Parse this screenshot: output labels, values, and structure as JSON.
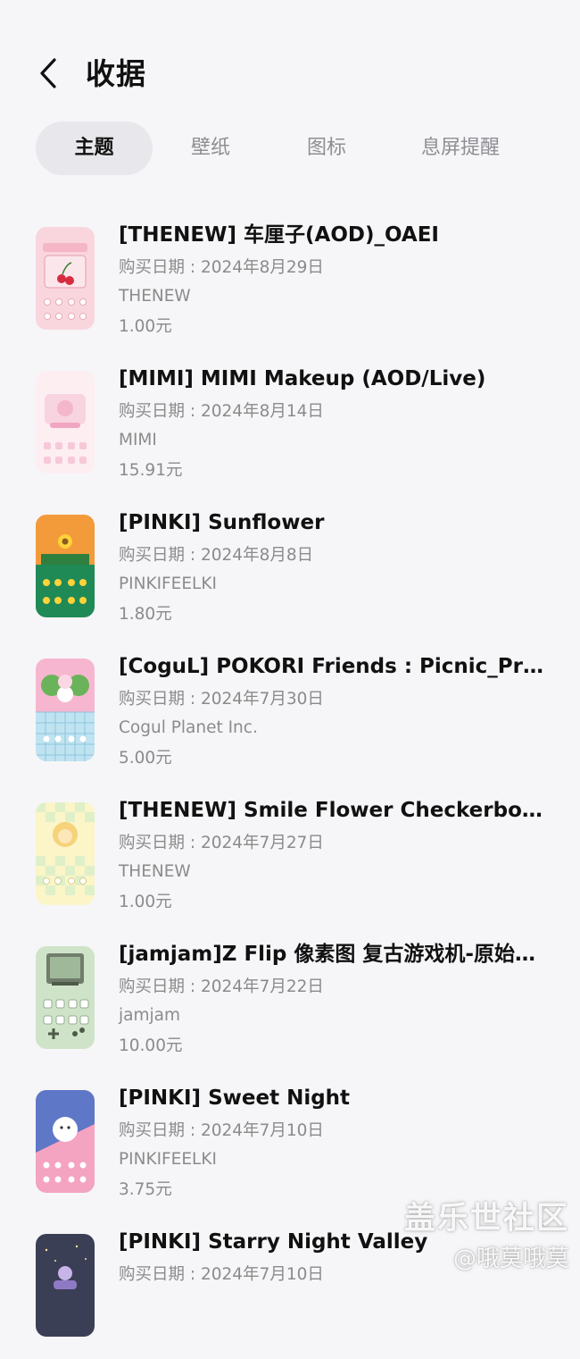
{
  "header": {
    "title": "收据"
  },
  "tabs": [
    {
      "label": "主题",
      "active": true
    },
    {
      "label": "壁纸",
      "active": false
    },
    {
      "label": "图标",
      "active": false
    },
    {
      "label": "息屏提醒",
      "active": false
    }
  ],
  "items": [
    {
      "name": "[THENEW] 车厘子(AOD)_OAEI",
      "date": "购买日期 : 2024年8月29日",
      "vendor": "THENEW",
      "price": "1.00元",
      "thumb_colors": [
        "#f9d6de",
        "#f6c2cf"
      ]
    },
    {
      "name": "[MIMI] MIMI Makeup (AOD/Live)",
      "date": "购买日期 : 2024年8月14日",
      "vendor": "MIMI",
      "price": "15.91元",
      "thumb_colors": [
        "#fdeef2",
        "#f7d5e0"
      ]
    },
    {
      "name": "[PINKI] Sunflower",
      "date": "购买日期 : 2024年8月8日",
      "vendor": "PINKIFEELKI",
      "price": "1.80元",
      "thumb_colors": [
        "#f39a3a",
        "#1f8a56"
      ]
    },
    {
      "name": "[CoguL] POKORI Friends : Picnic_Premium",
      "date": "购买日期 : 2024年7月30日",
      "vendor": "Cogul Planet Inc.",
      "price": "5.00元",
      "thumb_colors": [
        "#f7b6cf",
        "#a8d8ea"
      ]
    },
    {
      "name": "[THENEW] Smile Flower Checkerboard (AOD)",
      "date": "购买日期 : 2024年7月27日",
      "vendor": "THENEW",
      "price": "1.00元",
      "thumb_colors": [
        "#fbf5c8",
        "#dff0c8"
      ]
    },
    {
      "name": "[jamjam]Z Flip 像素图 复古游戏机-原始版本",
      "date": "购买日期 : 2024年7月22日",
      "vendor": "jamjam",
      "price": "10.00元",
      "thumb_colors": [
        "#cfe3c9",
        "#b7d3b0"
      ]
    },
    {
      "name": "[PINKI] Sweet Night",
      "date": "购买日期 : 2024年7月10日",
      "vendor": "PINKIFEELKI",
      "price": "3.75元",
      "thumb_colors": [
        "#5f77c7",
        "#f4a3c0"
      ]
    },
    {
      "name": "[PINKI] Starry Night Valley",
      "date": "购买日期 : 2024年7月10日",
      "vendor": "",
      "price": "",
      "thumb_colors": [
        "#3b3f56",
        "#2b2e40"
      ]
    }
  ],
  "watermark": {
    "line1": "盖乐世社区",
    "line2": "@哦莫哦莫"
  },
  "icons": {
    "back": "chevron-left-icon"
  }
}
